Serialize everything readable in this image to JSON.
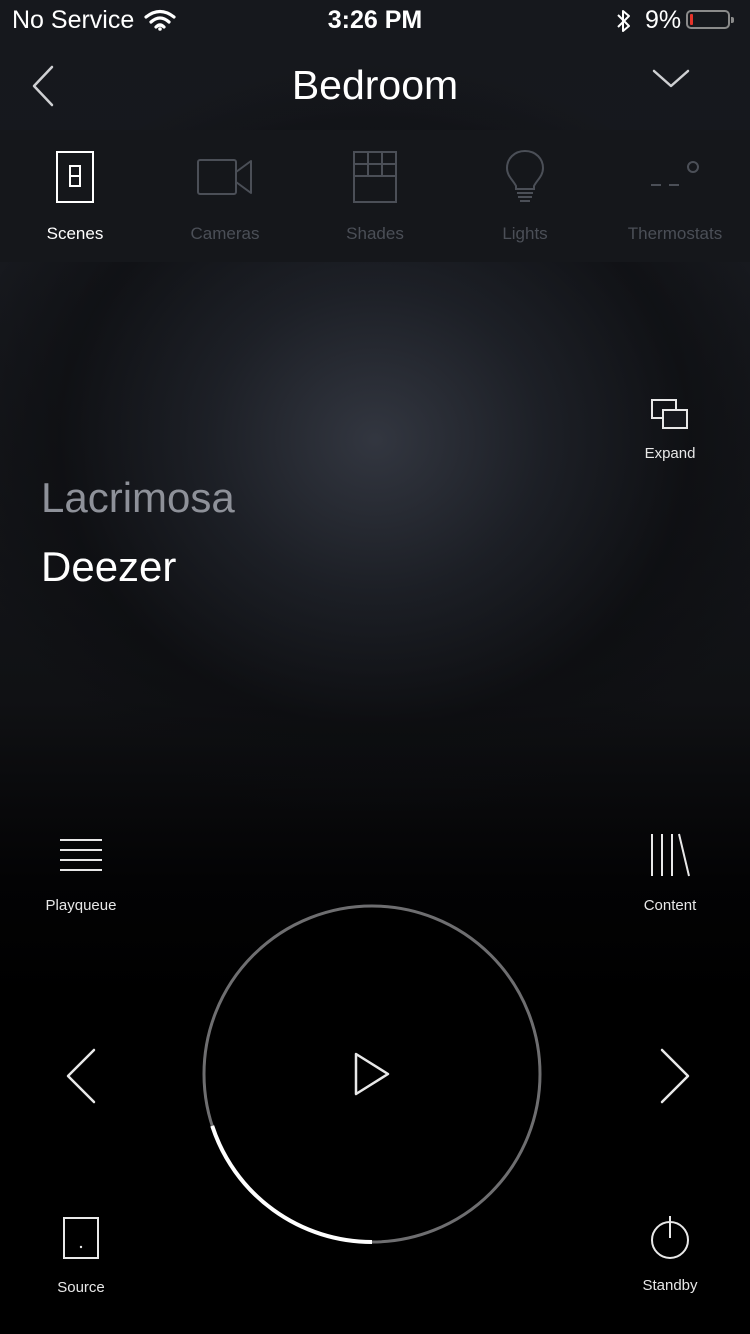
{
  "status": {
    "carrier": "No Service",
    "time": "3:26 PM",
    "battery": "9%",
    "battery_level": 0.09
  },
  "nav": {
    "title": "Bedroom"
  },
  "tabs": [
    {
      "label": "Scenes",
      "icon": "switch-icon",
      "active": true
    },
    {
      "label": "Cameras",
      "icon": "camera-icon",
      "active": false
    },
    {
      "label": "Shades",
      "icon": "shades-icon",
      "active": false
    },
    {
      "label": "Lights",
      "icon": "bulb-icon",
      "active": false
    },
    {
      "label": "Thermostats",
      "icon": "thermostat-icon",
      "active": false
    }
  ],
  "player": {
    "expand_label": "Expand",
    "track": "Lacrimosa",
    "service": "Deezer",
    "playqueue_label": "Playqueue",
    "content_label": "Content",
    "source_label": "Source",
    "standby_label": "Standby",
    "progress": 0.2
  },
  "colors": {
    "accent": "#ffffff",
    "inactive": "#4b4f57",
    "battery_low": "#e5332a"
  }
}
